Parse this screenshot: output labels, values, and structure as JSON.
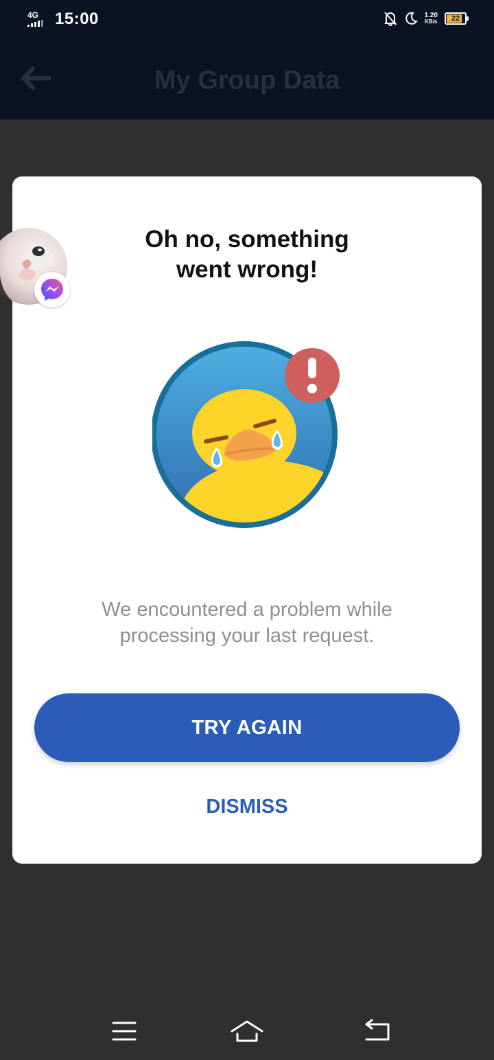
{
  "status_bar": {
    "network": "4G",
    "time": "15:00",
    "speed_value": "1.20",
    "speed_unit": "KB/s",
    "battery": "22",
    "icons": [
      "signal-icon",
      "mute-icon",
      "moon-icon",
      "battery-icon"
    ]
  },
  "app_bar": {
    "title": "My Group Data",
    "back_icon": "arrow-left-icon"
  },
  "dialog": {
    "title_line1": "Oh no, something",
    "title_line2": "went wrong!",
    "illustration": "crying-duck-error-icon",
    "message_line1": "We encountered a problem while",
    "message_line2": "processing your last request.",
    "primary_button": "TRY AGAIN",
    "secondary_button": "DISMISS"
  },
  "chat_head": {
    "avatar": "cat-avatar",
    "badge": "messenger-icon"
  },
  "nav_bar": {
    "icons": [
      "menu-icon",
      "home-icon",
      "back-icon"
    ]
  },
  "colors": {
    "status_bar_bg": "#0b1222",
    "overlay_bg": "#2f2f31",
    "primary": "#2b5cb7",
    "message_text": "#8f8f8f",
    "duck_yellow": "#fdd42a",
    "circle_blue": "#3d8fc7",
    "alert_red": "#d0605d"
  }
}
